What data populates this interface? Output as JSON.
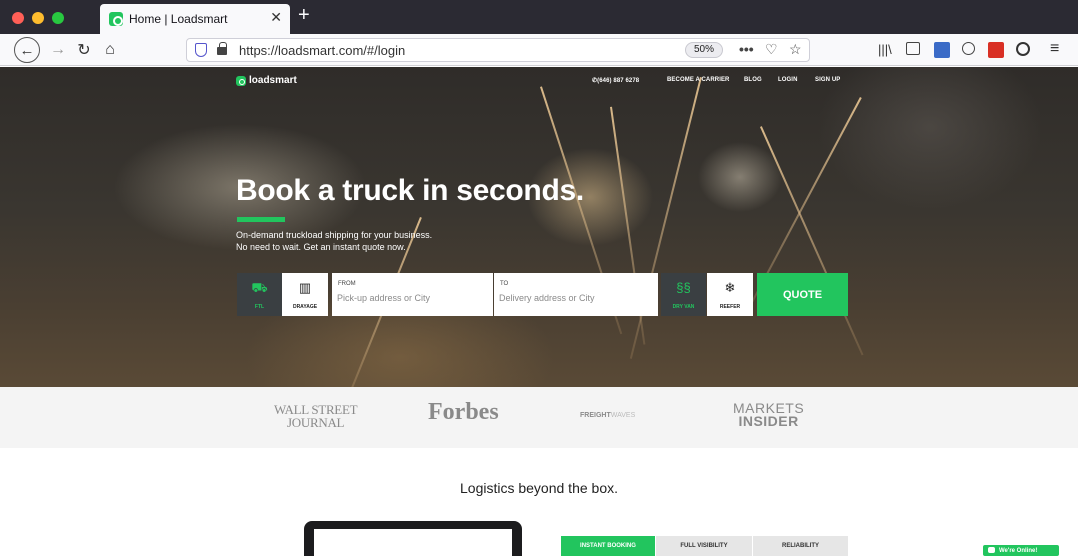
{
  "browser": {
    "tab_title": "Home | Loadsmart",
    "url": "https://loadsmart.com/#/login",
    "zoom": "50%",
    "traffic_colors": [
      "#ff5f57",
      "#febc2e",
      "#28c840"
    ]
  },
  "site": {
    "brand": "loadsmart",
    "nav": {
      "phone": "✆(646) 887 6278",
      "carrier": "BECOME A CARRIER",
      "blog": "BLOG",
      "login": "LOGIN",
      "signup": "SIGN UP"
    },
    "hero": {
      "headline": "Book a truck in seconds.",
      "sub_line1": "On-demand truckload shipping for your business.",
      "sub_line2": "No need to wait. Get an instant quote now."
    },
    "form": {
      "ftl": "FTL",
      "drayage": "DRAYAGE",
      "from_label": "FROM",
      "from_placeholder": "Pick-up address or City",
      "to_label": "TO",
      "to_placeholder": "Delivery address or City",
      "dry_van": "DRY VAN",
      "reefer": "REEFER",
      "quote": "QUOTE"
    },
    "press": {
      "wsj_line1": "WALL STREET",
      "wsj_line2": "JOURNAL",
      "forbes": "Forbes",
      "freightwaves_a": "FREIGHT",
      "freightwaves_b": "WAVES",
      "markets_line1": "MARKETS",
      "markets_line2": "INSIDER"
    },
    "tagline": "Logistics beyond the box.",
    "features": {
      "instant": "INSTANT BOOKING",
      "visibility": "FULL VISIBILITY",
      "reliability": "RELIABILITY"
    },
    "chat": "We're Online!",
    "accent_color": "#22c55e"
  }
}
